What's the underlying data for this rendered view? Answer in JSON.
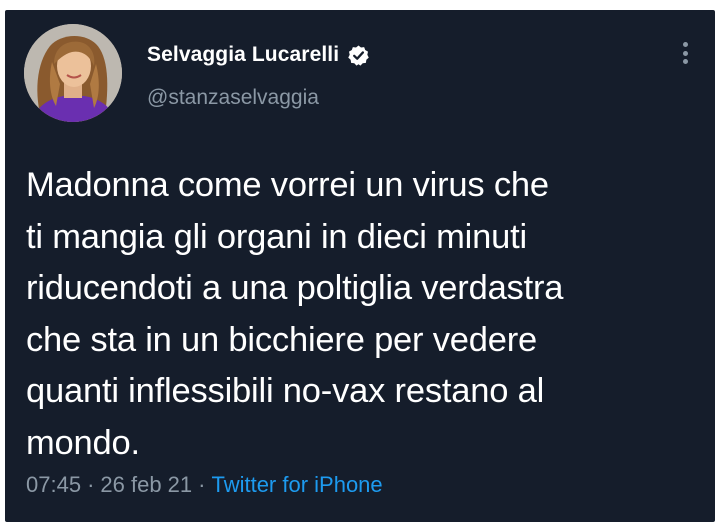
{
  "user": {
    "display_name": "Selvaggia Lucarelli",
    "handle": "@stanzaselvaggia",
    "verified_icon": "verified-badge-icon"
  },
  "tweet": {
    "lines": [
      "Madonna come vorrei un virus che",
      "ti mangia gli organi in dieci minuti",
      "riducendoti a una poltiglia verdastra",
      "che sta in un bicchiere per vedere",
      "quanti inflessibili no-vax restano al",
      "mondo."
    ]
  },
  "meta": {
    "time": "07:45",
    "separator": "·",
    "date": "26 feb 21",
    "source": "Twitter for iPhone"
  },
  "colors": {
    "background": "#151d2b",
    "text": "#ffffff",
    "secondary": "#8b98a5",
    "link": "#1d9bf0"
  }
}
